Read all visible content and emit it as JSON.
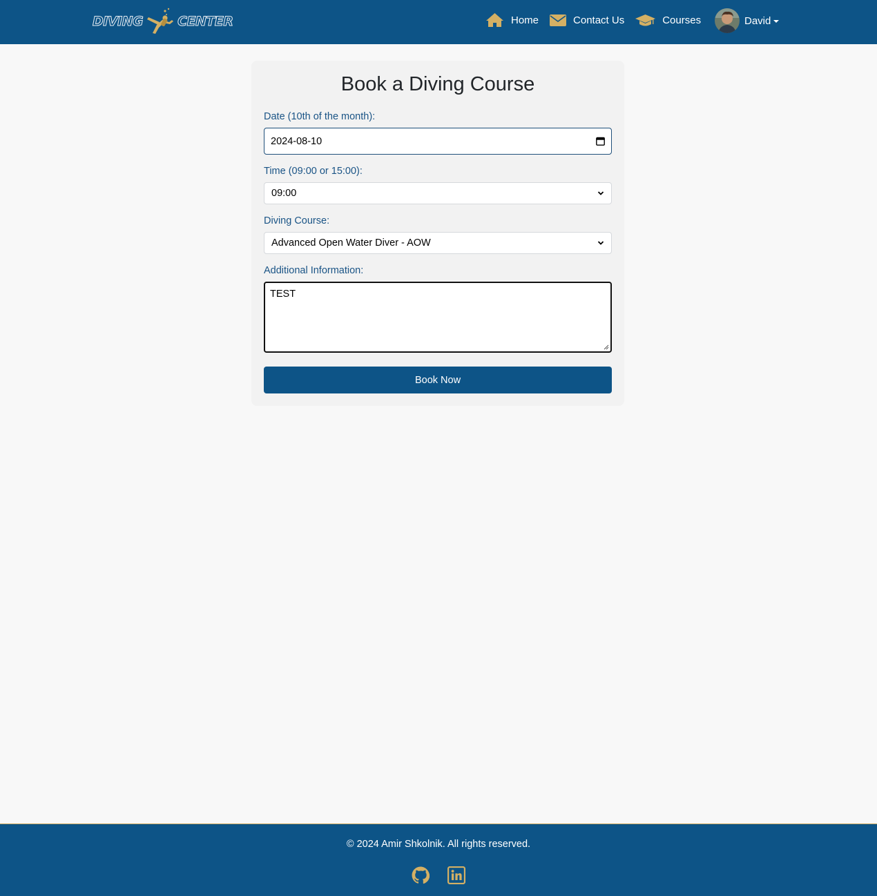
{
  "colors": {
    "primary": "#0d5487",
    "accent": "#d4b064",
    "label": "#1a5486",
    "background": "#f8f8f8"
  },
  "brand": {
    "word_left": "DIVING",
    "word_right": "CENTER",
    "icon": "scuba-diver-icon"
  },
  "nav": {
    "items": [
      {
        "label": "Home",
        "icon": "home-icon"
      },
      {
        "label": "Contact Us",
        "icon": "envelope-icon"
      },
      {
        "label": "Courses",
        "icon": "graduation-cap-icon"
      }
    ],
    "user": {
      "name": "David",
      "avatar": "user-avatar"
    }
  },
  "form": {
    "title": "Book a Diving Course",
    "date": {
      "label": "Date (10th of the month):",
      "value": "2024-08-10",
      "icon": "calendar-icon"
    },
    "time": {
      "label": "Time (09:00 or 15:00):",
      "value": "09:00"
    },
    "course": {
      "label": "Diving Course:",
      "value": "Advanced Open Water Diver - AOW"
    },
    "info": {
      "label": "Additional Information:",
      "value": "TEST"
    },
    "submit_label": "Book Now"
  },
  "footer": {
    "copyright": "© 2024 Amir Shkolnik. All rights reserved.",
    "links": [
      {
        "icon": "github-icon"
      },
      {
        "icon": "linkedin-icon"
      }
    ]
  }
}
